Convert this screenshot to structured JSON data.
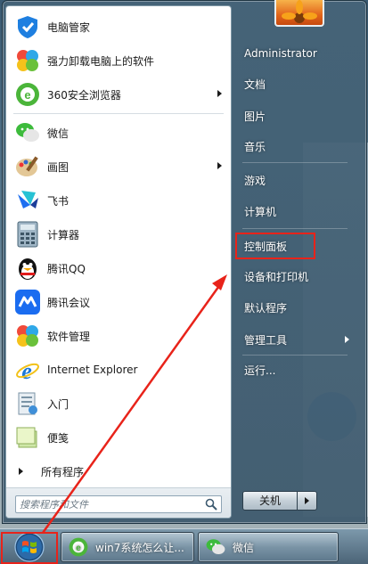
{
  "start_menu": {
    "programs": [
      {
        "label": "电脑管家",
        "icon": "tencent-pc-manager-icon",
        "submenu": false
      },
      {
        "label": "强力卸载电脑上的软件",
        "icon": "uninstall-icon",
        "submenu": false
      },
      {
        "label": "360安全浏览器",
        "icon": "360-browser-icon",
        "submenu": true
      },
      {
        "label": "微信",
        "icon": "wechat-icon",
        "submenu": false
      },
      {
        "label": "画图",
        "icon": "paint-icon",
        "submenu": true
      },
      {
        "label": "飞书",
        "icon": "feishu-icon",
        "submenu": false
      },
      {
        "label": "计算器",
        "icon": "calculator-icon",
        "submenu": false
      },
      {
        "label": "腾讯QQ",
        "icon": "qq-icon",
        "submenu": false
      },
      {
        "label": "腾讯会议",
        "icon": "tencent-meeting-icon",
        "submenu": false
      },
      {
        "label": "软件管理",
        "icon": "software-manager-icon",
        "submenu": false
      },
      {
        "label": "Internet Explorer",
        "icon": "internet-explorer-icon",
        "submenu": false
      },
      {
        "label": "入门",
        "icon": "getting-started-icon",
        "submenu": false
      },
      {
        "label": "便笺",
        "icon": "sticky-notes-icon",
        "submenu": false
      }
    ],
    "all_programs_label": "所有程序",
    "search_placeholder": "搜索程序和文件",
    "right_items": [
      {
        "label": "Administrator",
        "submenu": false
      },
      {
        "label": "文档",
        "submenu": false
      },
      {
        "label": "图片",
        "submenu": false
      },
      {
        "label": "音乐",
        "submenu": false
      },
      {
        "label": "游戏",
        "submenu": false
      },
      {
        "label": "计算机",
        "submenu": false
      },
      {
        "label": "控制面板",
        "submenu": false
      },
      {
        "label": "设备和打印机",
        "submenu": false
      },
      {
        "label": "默认程序",
        "submenu": false
      },
      {
        "label": "管理工具",
        "submenu": true
      },
      {
        "label": "运行...",
        "submenu": false
      }
    ],
    "shutdown_label": "关机"
  },
  "taskbar": {
    "buttons": [
      {
        "label": "win7系统怎么让...",
        "icon": "360-browser-icon"
      },
      {
        "label": "微信",
        "icon": "wechat-icon"
      }
    ]
  },
  "colors": {
    "annotation_red": "#e8231a",
    "menu_frame": "#46647a",
    "taskbar": "#5a7a90"
  }
}
